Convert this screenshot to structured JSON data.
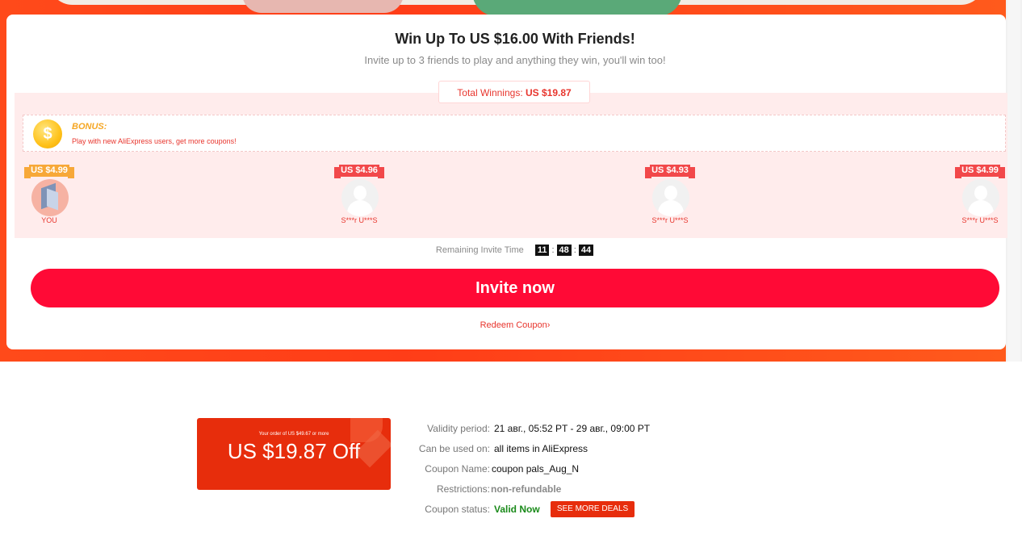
{
  "promo": {
    "title": "Win Up To US $16.00 With Friends!",
    "subtitle": "Invite up to 3 friends to play and anything they win, you'll win too!",
    "winnings_label": "Total Winnings:",
    "winnings_value": "US $19.87",
    "bonus_title": "BONUS:",
    "bonus_desc": "Play with new AliExpress users, get more coupons!",
    "coin_symbol": "$",
    "participants": [
      {
        "amount": "US $4.99",
        "name": "YOU",
        "ribbon": "gold"
      },
      {
        "amount": "US $4.96",
        "name": "S***r U***S",
        "ribbon": "red"
      },
      {
        "amount": "US $4.93",
        "name": "S***r U***S",
        "ribbon": "red"
      },
      {
        "amount": "US $4.99",
        "name": "S***r U***S",
        "ribbon": "red"
      }
    ],
    "timer": {
      "label": "Remaining Invite Time",
      "hours": "11",
      "minutes": "48",
      "seconds": "44"
    },
    "invite_button": "Invite now",
    "redeem_link": "Redeem Coupon",
    "redeem_chevron": "›"
  },
  "coupon": {
    "condition": "Your order of US $49.67 or more",
    "amount": "US $19.87 Off",
    "fields": [
      {
        "label": "Validity period:",
        "value": "21 авг., 05:52 PT - 29 авг., 09:00 PT"
      },
      {
        "label": "Can be used on:",
        "value": "all items in AliExpress"
      },
      {
        "label": "Coupon Name:",
        "value": "coupon pals_Aug_N"
      },
      {
        "label": "Restrictions:",
        "value": "non-refundable"
      },
      {
        "label": "Coupon status:",
        "value": "Valid Now"
      }
    ],
    "see_more_button": "SEE MORE DEALS"
  },
  "colors": {
    "accent": "#ff0a36",
    "promo_bg": "#ff4a1a",
    "coupon_bg": "#e72d0c",
    "status_green": "#1a8a1a"
  }
}
